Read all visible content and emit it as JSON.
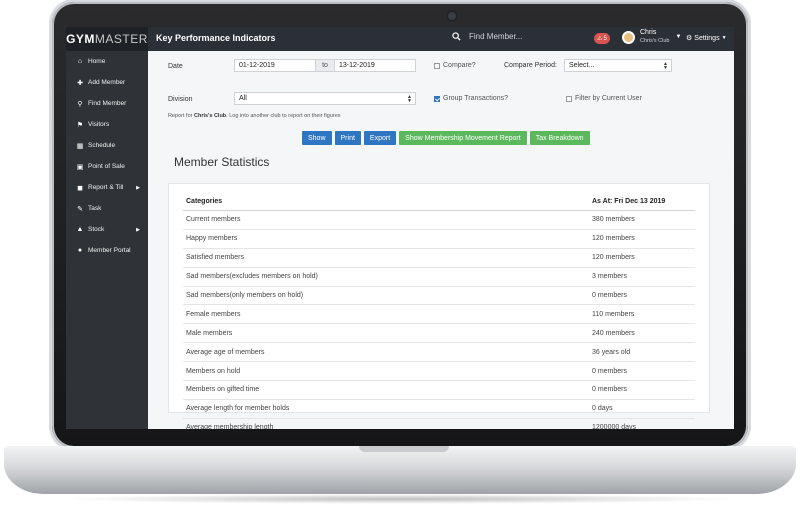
{
  "topbar": {
    "brand_main": "GYM",
    "brand_accent": "MASTER",
    "page_heading": "Key Performance Indicators",
    "search_placeholder": "Find Member...",
    "alert_count": "5",
    "user_name": "Chris",
    "user_club": "Chris's Club",
    "settings_label": "Settings"
  },
  "sidebar": {
    "items": [
      {
        "label": "Home",
        "icon": "home-icon"
      },
      {
        "label": "Add Member",
        "icon": "plus-icon"
      },
      {
        "label": "Find Member",
        "icon": "search-icon"
      },
      {
        "label": "Visitors",
        "icon": "tag-icon"
      },
      {
        "label": "Schedule",
        "icon": "calendar-icon"
      },
      {
        "label": "Point of Sale",
        "icon": "register-icon"
      },
      {
        "label": "Report & Till",
        "icon": "briefcase-icon"
      },
      {
        "label": "Task",
        "icon": "edit-icon"
      },
      {
        "label": "Stock",
        "icon": "tshirt-icon"
      },
      {
        "label": "Member Portal",
        "icon": "globe-icon"
      }
    ]
  },
  "filters": {
    "date_label": "Date",
    "date_from": "01-12-2019",
    "to_label": "to",
    "date_to": "13-12-2019",
    "compare_label": "Compare?",
    "compare_period_label": "Compare Period:",
    "compare_period_value": "Select...",
    "division_label": "Division",
    "division_value": "All",
    "group_transactions_label": "Group Transactions?",
    "filter_user_label": "Filter by Current User",
    "report_note_prefix": "Report for ",
    "report_note_club": "Chris's Club",
    "report_note_suffix": ". Log into another club to report on their figures"
  },
  "buttons": {
    "show": "Show",
    "print": "Print",
    "export": "Export",
    "membership_movement": "Show Membership Movement Report",
    "tax_breakdown": "Tax Breakdown"
  },
  "stats": {
    "title": "Member Statistics",
    "header_category": "Categories",
    "header_value": "As At: Fri Dec 13 2019",
    "rows": [
      {
        "category": "Current members",
        "value": "380 members"
      },
      {
        "category": "Happy members",
        "value": "120 members"
      },
      {
        "category": "Satisfied members",
        "value": "120 members"
      },
      {
        "category": "Sad members(excludes members on hold)",
        "value": "3 members"
      },
      {
        "category": "Sad members(only members on hold)",
        "value": "0 members"
      },
      {
        "category": "Female members",
        "value": "110 members"
      },
      {
        "category": "Male members",
        "value": "240 members"
      },
      {
        "category": "Average age of members",
        "value": "36 years old"
      },
      {
        "category": "Members on hold",
        "value": "0 members"
      },
      {
        "category": "Members on gifted time",
        "value": "0 members"
      },
      {
        "category": "Average length for member holds",
        "value": "0 days"
      },
      {
        "category": "Average membership length",
        "value": "1200000 days"
      }
    ]
  }
}
